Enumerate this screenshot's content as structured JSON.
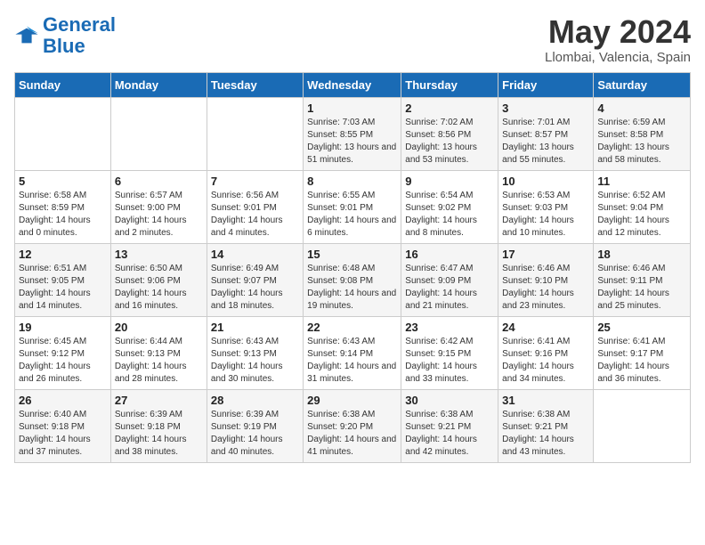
{
  "header": {
    "logo_general": "General",
    "logo_blue": "Blue",
    "month": "May 2024",
    "location": "Llombai, Valencia, Spain"
  },
  "days_of_week": [
    "Sunday",
    "Monday",
    "Tuesday",
    "Wednesday",
    "Thursday",
    "Friday",
    "Saturday"
  ],
  "weeks": [
    [
      {
        "num": "",
        "sunrise": "",
        "sunset": "",
        "daylight": ""
      },
      {
        "num": "",
        "sunrise": "",
        "sunset": "",
        "daylight": ""
      },
      {
        "num": "",
        "sunrise": "",
        "sunset": "",
        "daylight": ""
      },
      {
        "num": "1",
        "sunrise": "Sunrise: 7:03 AM",
        "sunset": "Sunset: 8:55 PM",
        "daylight": "Daylight: 13 hours and 51 minutes."
      },
      {
        "num": "2",
        "sunrise": "Sunrise: 7:02 AM",
        "sunset": "Sunset: 8:56 PM",
        "daylight": "Daylight: 13 hours and 53 minutes."
      },
      {
        "num": "3",
        "sunrise": "Sunrise: 7:01 AM",
        "sunset": "Sunset: 8:57 PM",
        "daylight": "Daylight: 13 hours and 55 minutes."
      },
      {
        "num": "4",
        "sunrise": "Sunrise: 6:59 AM",
        "sunset": "Sunset: 8:58 PM",
        "daylight": "Daylight: 13 hours and 58 minutes."
      }
    ],
    [
      {
        "num": "5",
        "sunrise": "Sunrise: 6:58 AM",
        "sunset": "Sunset: 8:59 PM",
        "daylight": "Daylight: 14 hours and 0 minutes."
      },
      {
        "num": "6",
        "sunrise": "Sunrise: 6:57 AM",
        "sunset": "Sunset: 9:00 PM",
        "daylight": "Daylight: 14 hours and 2 minutes."
      },
      {
        "num": "7",
        "sunrise": "Sunrise: 6:56 AM",
        "sunset": "Sunset: 9:01 PM",
        "daylight": "Daylight: 14 hours and 4 minutes."
      },
      {
        "num": "8",
        "sunrise": "Sunrise: 6:55 AM",
        "sunset": "Sunset: 9:01 PM",
        "daylight": "Daylight: 14 hours and 6 minutes."
      },
      {
        "num": "9",
        "sunrise": "Sunrise: 6:54 AM",
        "sunset": "Sunset: 9:02 PM",
        "daylight": "Daylight: 14 hours and 8 minutes."
      },
      {
        "num": "10",
        "sunrise": "Sunrise: 6:53 AM",
        "sunset": "Sunset: 9:03 PM",
        "daylight": "Daylight: 14 hours and 10 minutes."
      },
      {
        "num": "11",
        "sunrise": "Sunrise: 6:52 AM",
        "sunset": "Sunset: 9:04 PM",
        "daylight": "Daylight: 14 hours and 12 minutes."
      }
    ],
    [
      {
        "num": "12",
        "sunrise": "Sunrise: 6:51 AM",
        "sunset": "Sunset: 9:05 PM",
        "daylight": "Daylight: 14 hours and 14 minutes."
      },
      {
        "num": "13",
        "sunrise": "Sunrise: 6:50 AM",
        "sunset": "Sunset: 9:06 PM",
        "daylight": "Daylight: 14 hours and 16 minutes."
      },
      {
        "num": "14",
        "sunrise": "Sunrise: 6:49 AM",
        "sunset": "Sunset: 9:07 PM",
        "daylight": "Daylight: 14 hours and 18 minutes."
      },
      {
        "num": "15",
        "sunrise": "Sunrise: 6:48 AM",
        "sunset": "Sunset: 9:08 PM",
        "daylight": "Daylight: 14 hours and 19 minutes."
      },
      {
        "num": "16",
        "sunrise": "Sunrise: 6:47 AM",
        "sunset": "Sunset: 9:09 PM",
        "daylight": "Daylight: 14 hours and 21 minutes."
      },
      {
        "num": "17",
        "sunrise": "Sunrise: 6:46 AM",
        "sunset": "Sunset: 9:10 PM",
        "daylight": "Daylight: 14 hours and 23 minutes."
      },
      {
        "num": "18",
        "sunrise": "Sunrise: 6:46 AM",
        "sunset": "Sunset: 9:11 PM",
        "daylight": "Daylight: 14 hours and 25 minutes."
      }
    ],
    [
      {
        "num": "19",
        "sunrise": "Sunrise: 6:45 AM",
        "sunset": "Sunset: 9:12 PM",
        "daylight": "Daylight: 14 hours and 26 minutes."
      },
      {
        "num": "20",
        "sunrise": "Sunrise: 6:44 AM",
        "sunset": "Sunset: 9:13 PM",
        "daylight": "Daylight: 14 hours and 28 minutes."
      },
      {
        "num": "21",
        "sunrise": "Sunrise: 6:43 AM",
        "sunset": "Sunset: 9:13 PM",
        "daylight": "Daylight: 14 hours and 30 minutes."
      },
      {
        "num": "22",
        "sunrise": "Sunrise: 6:43 AM",
        "sunset": "Sunset: 9:14 PM",
        "daylight": "Daylight: 14 hours and 31 minutes."
      },
      {
        "num": "23",
        "sunrise": "Sunrise: 6:42 AM",
        "sunset": "Sunset: 9:15 PM",
        "daylight": "Daylight: 14 hours and 33 minutes."
      },
      {
        "num": "24",
        "sunrise": "Sunrise: 6:41 AM",
        "sunset": "Sunset: 9:16 PM",
        "daylight": "Daylight: 14 hours and 34 minutes."
      },
      {
        "num": "25",
        "sunrise": "Sunrise: 6:41 AM",
        "sunset": "Sunset: 9:17 PM",
        "daylight": "Daylight: 14 hours and 36 minutes."
      }
    ],
    [
      {
        "num": "26",
        "sunrise": "Sunrise: 6:40 AM",
        "sunset": "Sunset: 9:18 PM",
        "daylight": "Daylight: 14 hours and 37 minutes."
      },
      {
        "num": "27",
        "sunrise": "Sunrise: 6:39 AM",
        "sunset": "Sunset: 9:18 PM",
        "daylight": "Daylight: 14 hours and 38 minutes."
      },
      {
        "num": "28",
        "sunrise": "Sunrise: 6:39 AM",
        "sunset": "Sunset: 9:19 PM",
        "daylight": "Daylight: 14 hours and 40 minutes."
      },
      {
        "num": "29",
        "sunrise": "Sunrise: 6:38 AM",
        "sunset": "Sunset: 9:20 PM",
        "daylight": "Daylight: 14 hours and 41 minutes."
      },
      {
        "num": "30",
        "sunrise": "Sunrise: 6:38 AM",
        "sunset": "Sunset: 9:21 PM",
        "daylight": "Daylight: 14 hours and 42 minutes."
      },
      {
        "num": "31",
        "sunrise": "Sunrise: 6:38 AM",
        "sunset": "Sunset: 9:21 PM",
        "daylight": "Daylight: 14 hours and 43 minutes."
      },
      {
        "num": "",
        "sunrise": "",
        "sunset": "",
        "daylight": ""
      }
    ]
  ]
}
